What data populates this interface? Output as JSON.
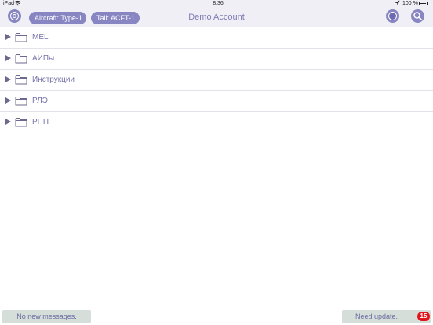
{
  "status_bar": {
    "device": "iPad",
    "time": "8:36",
    "battery_percent": "100 %"
  },
  "nav": {
    "aircraft_label": "Aircraft: Type-1",
    "tail_label": "Tail: ACFT-1",
    "title": "Demo Account"
  },
  "folders": [
    {
      "label": "MEL"
    },
    {
      "label": "АИПы"
    },
    {
      "label": "Инструкции"
    },
    {
      "label": "РЛЭ"
    },
    {
      "label": "РПП"
    }
  ],
  "footer": {
    "messages_label": "No new messages.",
    "update_label": "Need update.",
    "update_count": "15"
  },
  "colors": {
    "accent": "#8785c2",
    "badge": "#e0141c",
    "footer_button": "#d5ded9"
  }
}
